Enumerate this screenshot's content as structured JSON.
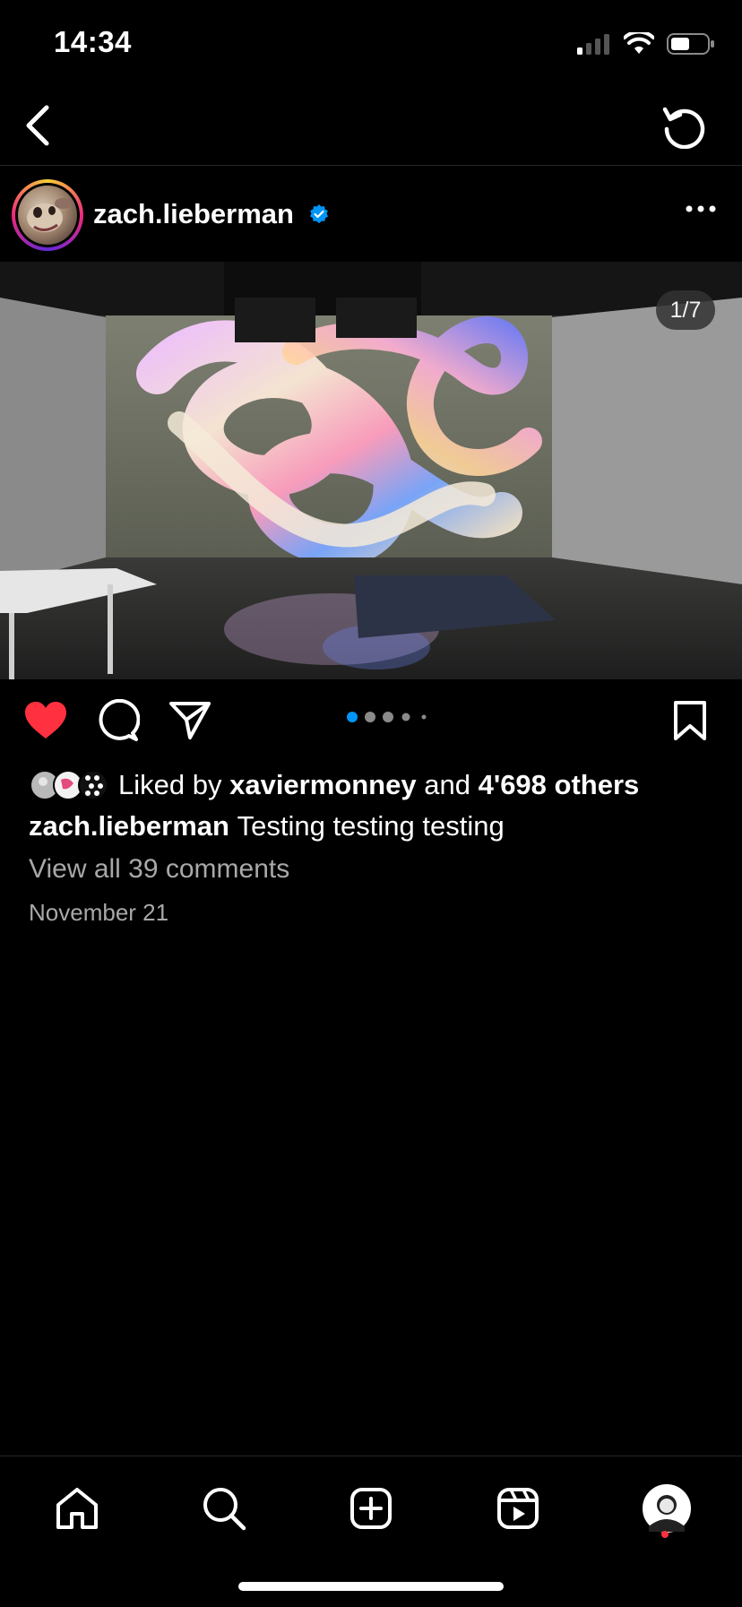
{
  "status_bar": {
    "time": "14:34"
  },
  "post": {
    "username": "zach.lieberman",
    "slide_indicator": "1/7",
    "liked_by_prefix": "Liked by",
    "liked_by_user": "xaviermonney",
    "liked_by_and": "and",
    "liked_by_others": "4'698 others",
    "caption_user": "zach.lieberman",
    "caption_text": "Testing testing testing",
    "view_comments": "View all 39 comments",
    "date": "November 21",
    "liked": true,
    "verified": true,
    "carousel_dots": 5,
    "active_dot": 1
  },
  "icons": {
    "nav": [
      "back-arrow-icon",
      "refresh-icon"
    ],
    "header": [
      "verified-badge-icon",
      "more-options-icon"
    ],
    "actions": [
      "heart-icon",
      "comment-icon",
      "share-icon",
      "bookmark-icon"
    ],
    "tabs": [
      "home-icon",
      "search-icon",
      "create-post-icon",
      "reels-icon",
      "profile-avatar"
    ]
  },
  "colors": {
    "like_red": "#ff3040",
    "verified_blue": "#0095f6",
    "active_dot_blue": "#0095f6",
    "muted_text": "#a8a8a8",
    "notification_dot": "#ff3040"
  }
}
